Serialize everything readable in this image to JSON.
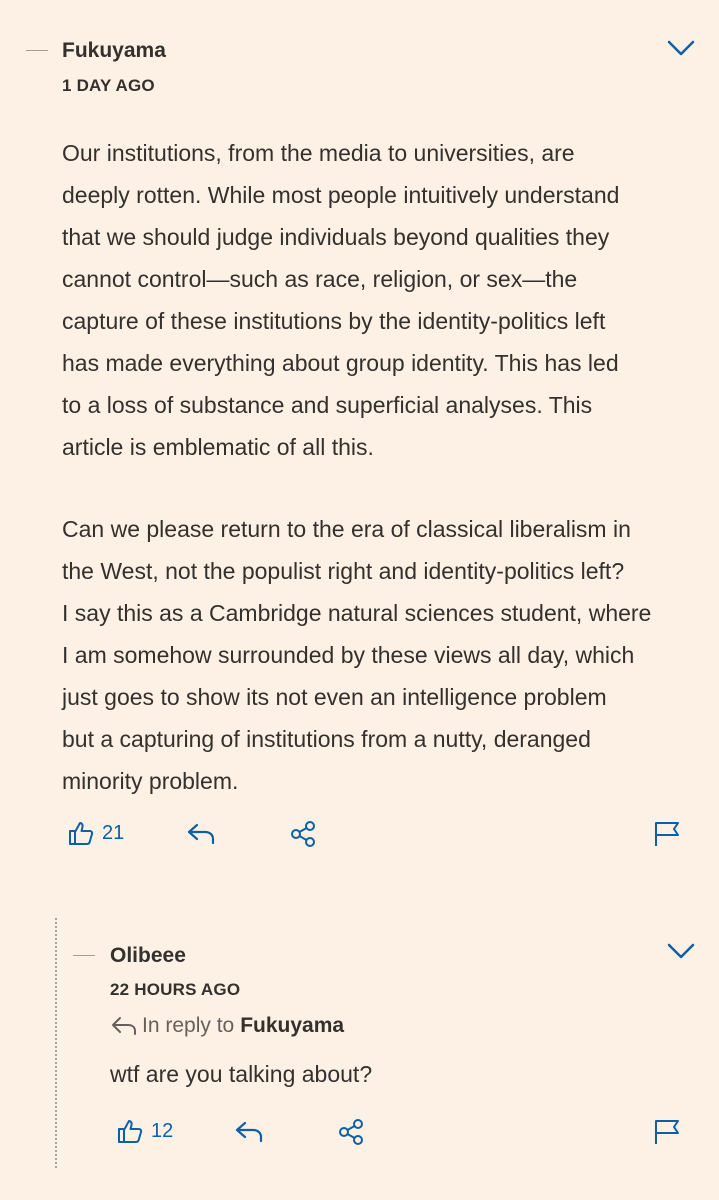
{
  "comments": [
    {
      "author": "Fukuyama",
      "time": "1 DAY AGO",
      "paragraphs": [
        [
          "Our institutions, from the media to universities, are",
          "deeply rotten. While most people intuitively understand",
          "that we should judge individuals beyond qualities they",
          "cannot control—such as race, religion, or sex—the",
          "capture of these institutions by the identity-politics left",
          "has made everything about group identity. This has led",
          "to a loss of substance and superficial analyses. This",
          "article is emblematic of all this."
        ],
        [
          "Can we please return to the era of classical liberalism in",
          "the West, not the populist right and identity-politics left?",
          "I say this as a Cambridge natural sciences student, where",
          "I am somehow surrounded by these views all day, which",
          "just goes to show its not even an intelligence problem",
          "but a capturing of institutions from a nutty, deranged",
          "minority problem."
        ]
      ],
      "likes": "21"
    }
  ],
  "reply": {
    "author": "Olibeee",
    "time": "22 HOURS AGO",
    "in_reply_to_label": "In reply to",
    "in_reply_to_name": "Fukuyama",
    "text": "wtf are you talking about?",
    "likes": "12"
  },
  "colors": {
    "background": "#fdf1e5",
    "accent": "#0d5fa6",
    "text": "#33302e"
  },
  "icons": [
    "thumbs-up-icon",
    "reply-icon",
    "share-icon",
    "flag-icon",
    "chevron-down-icon",
    "reply-arrow-icon"
  ]
}
